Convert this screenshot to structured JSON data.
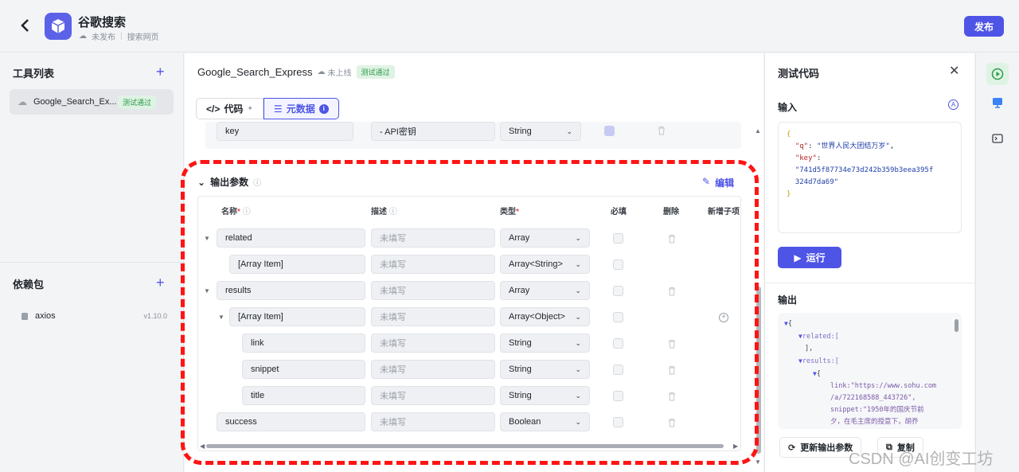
{
  "app": {
    "title": "谷歌搜索",
    "status": "未发布",
    "category": "搜索网页",
    "publish_label": "发布"
  },
  "sidebar": {
    "tools_title": "工具列表",
    "tool_item": {
      "name": "Google_Search_Ex...",
      "badge": "测试通过"
    },
    "deps_title": "依赖包",
    "dep_item": {
      "name": "axios",
      "version": "v1.10.0"
    }
  },
  "main": {
    "title": "Google_Search_Express",
    "online_status": "未上线",
    "badge": "测试通过",
    "tabs": [
      "代码",
      "元数据"
    ],
    "input_row": {
      "name": "key",
      "desc": "- API密钥",
      "type": "String"
    },
    "output": {
      "title": "输出参数",
      "edit_label": "编辑",
      "headers": {
        "name": "名称",
        "desc": "描述",
        "type": "类型",
        "required": "必填",
        "delete": "删除",
        "add_child": "新增子项"
      },
      "placeholder": "未填写",
      "rows": [
        {
          "name": "related",
          "type": "Array"
        },
        {
          "name": "[Array Item]",
          "type": "Array<String>"
        },
        {
          "name": "results",
          "type": "Array"
        },
        {
          "name": "[Array Item]",
          "type": "Array<Object>"
        },
        {
          "name": "link",
          "type": "String"
        },
        {
          "name": "snippet",
          "type": "String"
        },
        {
          "name": "title",
          "type": "String"
        },
        {
          "name": "success",
          "type": "Boolean"
        }
      ]
    }
  },
  "test_panel": {
    "title": "测试代码",
    "input_label": "输入",
    "input_code": {
      "q_key": "\"q\"",
      "q_val": "\"世界人民大团结万岁\"",
      "key_key": "\"key\"",
      "key_val_1": "\"741d5f87734e73d242b359b3eea395f",
      "key_val_2": "324d7da69\""
    },
    "run_label": "运行",
    "output_label": "输出",
    "output_tree": {
      "related": "related:[",
      "related_close": "],",
      "results": "results:[",
      "link": "link:\"https://www.sohu.com",
      "link2": "/a/722168588_443726\",",
      "snippet": "snippet:\"1950年的国庆节前",
      "snippet2": "夕，在毛主席的授意下，胡乔"
    },
    "update_label": "更新输出参数",
    "copy_label": "复制"
  },
  "watermark": "CSDN @AI创变工坊"
}
